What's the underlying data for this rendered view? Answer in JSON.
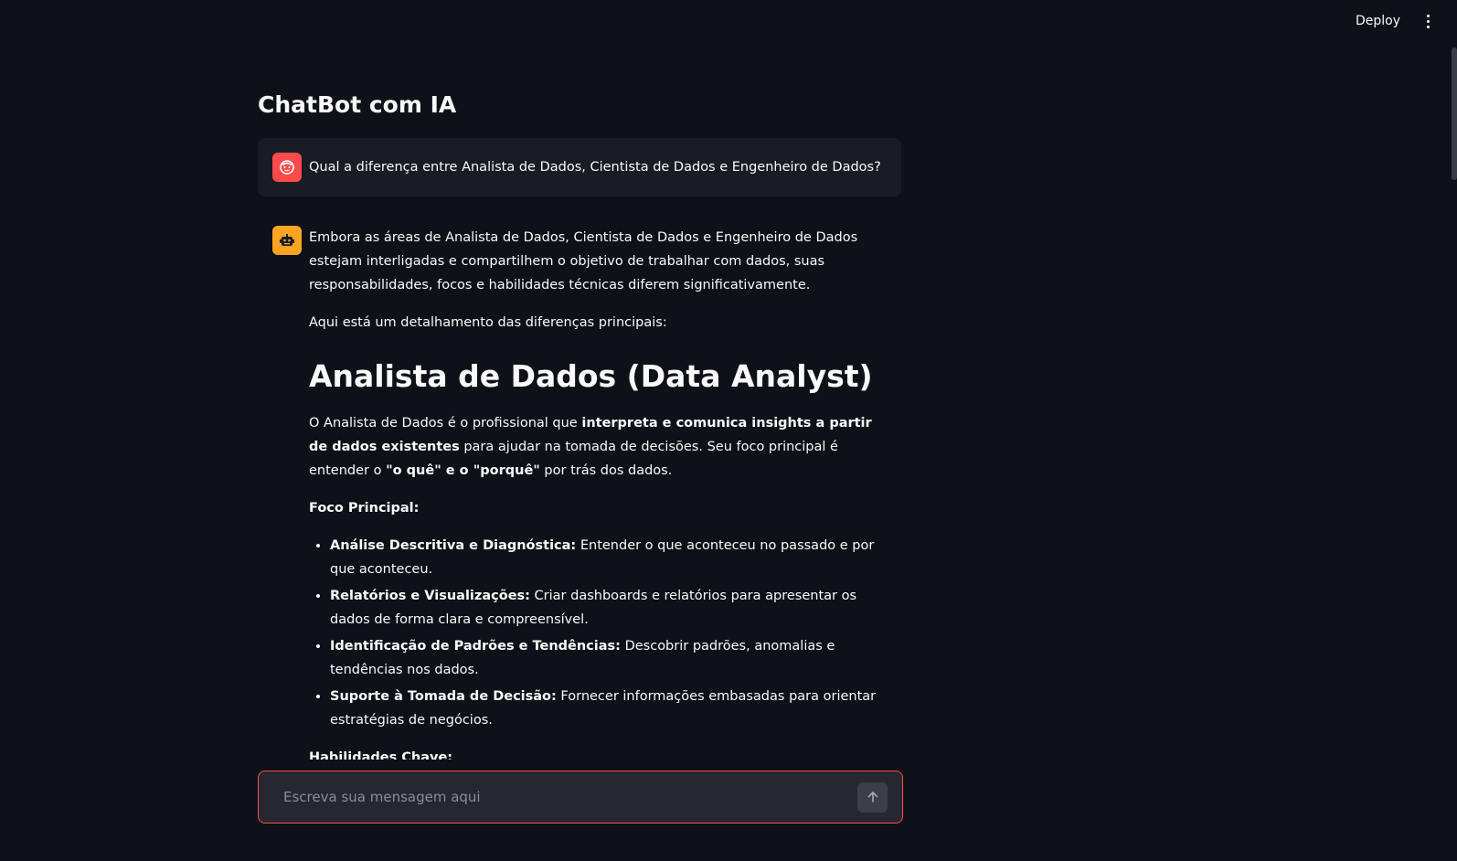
{
  "topbar": {
    "deploy_label": "Deploy",
    "menu_icon": "kebab-menu-icon"
  },
  "page": {
    "title": "ChatBot com IA"
  },
  "user_message": {
    "avatar_icon": "user-face-icon",
    "text": "Qual a diferença entre Analista de Dados, Cientista de Dados e Engenheiro de Dados?"
  },
  "assistant_message": {
    "avatar_icon": "robot-icon",
    "intro": "Embora as áreas de Analista de Dados, Cientista de Dados e Engenheiro de Dados estejam interligadas e compartilhem o objetivo de trabalhar com dados, suas responsabilidades, focos e habilidades técnicas diferem significativamente.",
    "detail": "Aqui está um detalhamento das diferenças principais:",
    "heading": "Analista de Dados (Data Analyst)",
    "desc_1": "O Analista de Dados é o profissional que ",
    "desc_bold_1": "interpreta e comunica insights a partir de dados existentes",
    "desc_2": " para ajudar na tomada de decisões. Seu foco principal é entender o ",
    "desc_bold_2": "\"o quê\" e o \"porquê\"",
    "desc_3": " por trás dos dados.",
    "focus_title": "Foco Principal:",
    "focus_items": [
      {
        "label": "Análise Descritiva e Diagnóstica:",
        "text": " Entender o que aconteceu no passado e por que aconteceu."
      },
      {
        "label": "Relatórios e Visualizações:",
        "text": " Criar dashboards e relatórios para apresentar os dados de forma clara e compreensível."
      },
      {
        "label": "Identificação de Padrões e Tendências:",
        "text": " Descobrir padrões, anomalias e tendências nos dados."
      },
      {
        "label": "Suporte à Tomada de Decisão:",
        "text": " Fornecer informações embasadas para orientar estratégias de negócios."
      }
    ],
    "skills_title": "Habilidades Chave:"
  },
  "chat_input": {
    "placeholder": "Escreva sua mensagem aqui",
    "send_icon": "arrow-up-icon"
  },
  "colors": {
    "background": "#0e1117",
    "accent": "#ff4b4b",
    "bot_avatar": "#ffa421",
    "user_bubble": "#1a1c24",
    "input_bg": "#262730"
  }
}
